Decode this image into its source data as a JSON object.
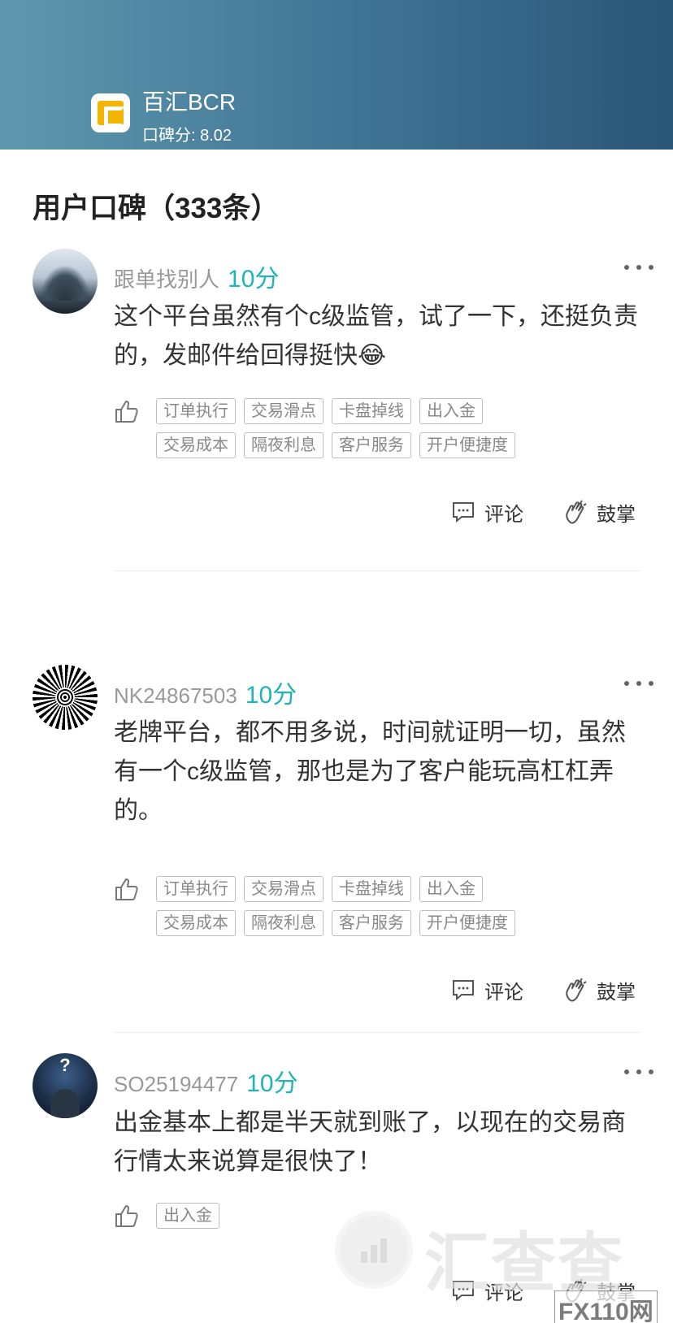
{
  "header": {
    "broker_name": "百汇BCR",
    "score_label": "口碑分: 8.02",
    "gradient_start": "#5e97ad",
    "gradient_end": "#2a5677"
  },
  "section": {
    "title": "用户口碑（333条）"
  },
  "reviews": [
    {
      "username": "跟单找别人",
      "score": "10分",
      "avatar": "mountain-landscape-avatar",
      "content": "这个平台虽然有个c级监管，试了一下，还挺负责的，发邮件给回得挺快😂",
      "tags_row1": [
        "订单执行",
        "交易滑点",
        "卡盘掉线",
        "出入金"
      ],
      "tags_row2": [
        "交易成本",
        "隔夜利息",
        "客户服务",
        "开户便捷度"
      ],
      "comment_label": "评论",
      "clap_label": "鼓掌"
    },
    {
      "username": "NK24867503",
      "score": "10分",
      "avatar": "spiral-pattern-avatar",
      "content": "老牌平台，都不用多说，时间就证明一切，虽然有一个c级监管，那也是为了客户能玩高杠杠弄的。",
      "tags_row1": [
        "订单执行",
        "交易滑点",
        "卡盘掉线",
        "出入金"
      ],
      "tags_row2": [
        "交易成本",
        "隔夜利息",
        "客户服务",
        "开户便捷度"
      ],
      "comment_label": "评论",
      "clap_label": "鼓掌"
    },
    {
      "username": "SO25194477",
      "score": "10分",
      "avatar": "person-question-avatar",
      "avatar_mark": "?",
      "content": "出金基本上都是半天就到账了，以现在的交易商行情太来说算是很快了！",
      "tags_row1": [
        "出入金"
      ],
      "comment_label": "评论",
      "clap_label": "鼓掌"
    }
  ],
  "watermark": {
    "text": "汇查查",
    "sub": "FX110网"
  },
  "colors": {
    "score": "#1fb5b5",
    "username": "#999999",
    "tag_border": "#bdbdbd"
  }
}
